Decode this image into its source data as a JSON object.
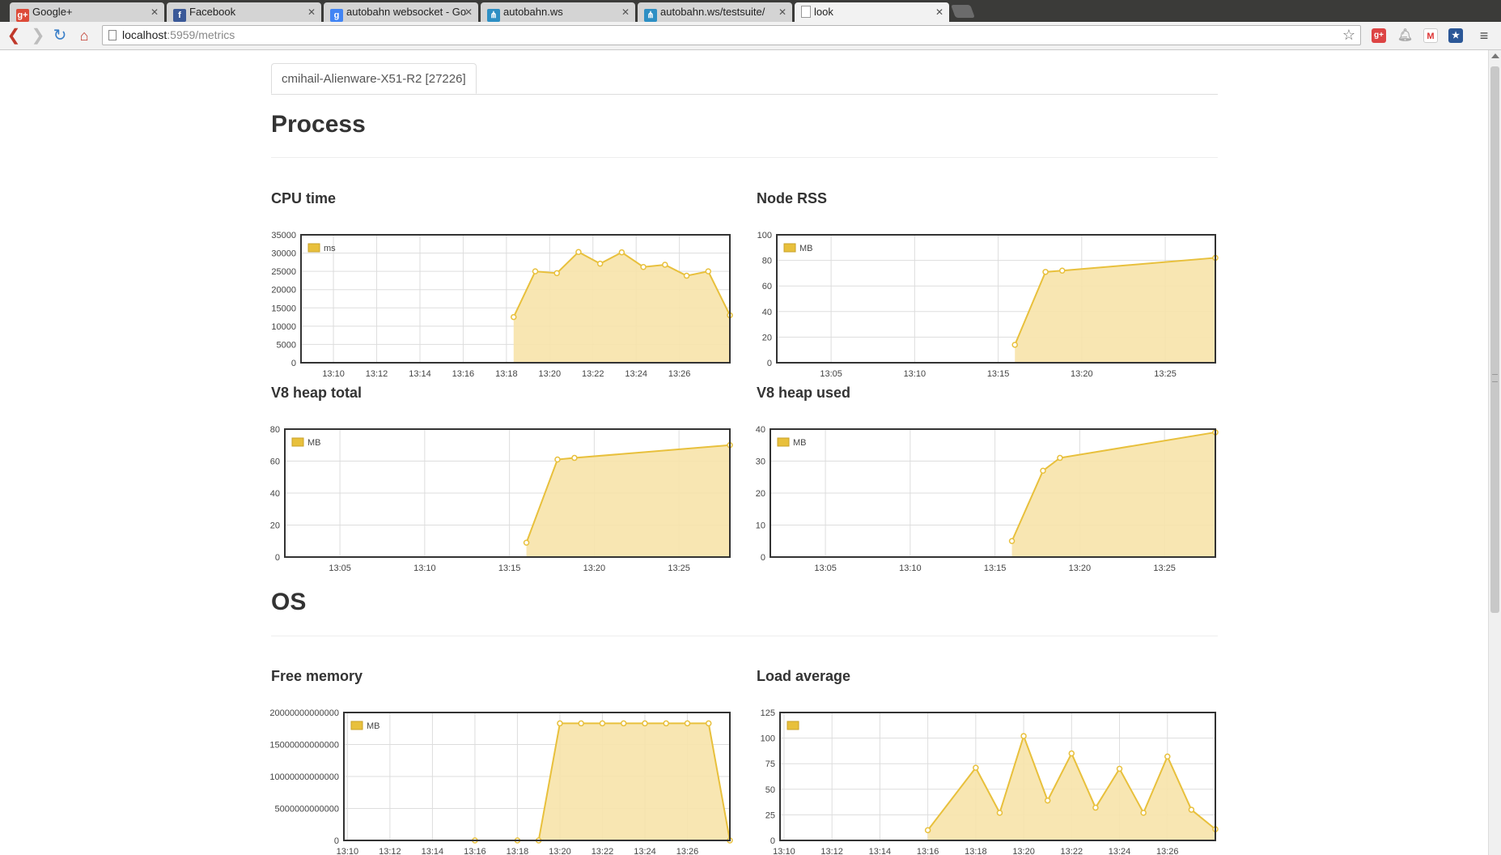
{
  "browser": {
    "tabs": [
      {
        "title": "Google+",
        "icon": "google-plus-icon",
        "color": "#dd4b39",
        "glyph": "g+"
      },
      {
        "title": "Facebook",
        "icon": "facebook-icon",
        "color": "#3b5998",
        "glyph": "f"
      },
      {
        "title": "autobahn websocket - Go",
        "icon": "google-search-icon",
        "color": "#4285f4",
        "glyph": "g"
      },
      {
        "title": "autobahn.ws",
        "icon": "autobahn-icon",
        "color": "#2d8fc4",
        "glyph": "⋔"
      },
      {
        "title": "autobahn.ws/testsuite/",
        "icon": "autobahn-icon",
        "color": "#2d8fc4",
        "glyph": "⋔"
      },
      {
        "title": "look",
        "icon": "page-icon",
        "color": "#ffffff",
        "glyph": ""
      }
    ],
    "active_tab": 5,
    "url_host": "localhost",
    "url_rest": ":5959/metrics"
  },
  "page": {
    "host_tab": "cmihail-Alienware-X51-R2 [27226]",
    "sections": {
      "process": "Process",
      "os": "OS"
    }
  },
  "colors": {
    "series_line": "#e8c03c",
    "series_fill": "#f7e3aa",
    "legend_swatch": "#e8c03c",
    "grid": "#dddddd",
    "frame": "#333333"
  },
  "chart_data": [
    {
      "id": "cpu",
      "type": "area",
      "title": "CPU time",
      "legend": "ms",
      "x_unit": "time",
      "xlim": [
        "13:08:30",
        "13:28:20"
      ],
      "ylim": [
        0,
        35000
      ],
      "yticks": [
        0,
        5000,
        10000,
        15000,
        20000,
        25000,
        30000,
        35000
      ],
      "xticks": [
        "13:10",
        "13:12",
        "13:14",
        "13:16",
        "13:18",
        "13:20",
        "13:22",
        "13:24",
        "13:26"
      ],
      "x": [
        "13:18:20",
        "13:19:20",
        "13:20:20",
        "13:21:20",
        "13:22:20",
        "13:23:20",
        "13:24:20",
        "13:25:20",
        "13:26:20",
        "13:27:20",
        "13:28:20"
      ],
      "y": [
        12500,
        25000,
        24500,
        30300,
        27100,
        30200,
        26200,
        26800,
        23800,
        25000,
        13000
      ]
    },
    {
      "id": "rss",
      "type": "area",
      "title": "Node RSS",
      "legend": "MB",
      "x_unit": "time",
      "xlim": [
        "13:01:45",
        "13:28:00"
      ],
      "ylim": [
        0,
        100
      ],
      "yticks": [
        0,
        20,
        40,
        60,
        80,
        100
      ],
      "xticks": [
        "13:05",
        "13:10",
        "13:15",
        "13:20",
        "13:25"
      ],
      "x": [
        "13:16:00",
        "13:17:50",
        "13:18:50",
        "13:28:00"
      ],
      "y": [
        14,
        71,
        72,
        82
      ]
    },
    {
      "id": "heap_total",
      "type": "area",
      "title": "V8 heap total",
      "legend": "MB",
      "x_unit": "time",
      "xlim": [
        "13:01:45",
        "13:28:00"
      ],
      "ylim": [
        0,
        80
      ],
      "yticks": [
        0,
        20,
        40,
        60,
        80
      ],
      "xticks": [
        "13:05",
        "13:10",
        "13:15",
        "13:20",
        "13:25"
      ],
      "x": [
        "13:16:00",
        "13:17:50",
        "13:18:50",
        "13:28:00"
      ],
      "y": [
        9,
        61,
        62,
        70
      ]
    },
    {
      "id": "heap_used",
      "type": "area",
      "title": "V8 heap used",
      "legend": "MB",
      "x_unit": "time",
      "xlim": [
        "13:01:45",
        "13:28:00"
      ],
      "ylim": [
        0,
        40
      ],
      "yticks": [
        0,
        10,
        20,
        30,
        40
      ],
      "xticks": [
        "13:05",
        "13:10",
        "13:15",
        "13:20",
        "13:25"
      ],
      "x": [
        "13:16:00",
        "13:17:50",
        "13:18:50",
        "13:28:00"
      ],
      "y": [
        5,
        27,
        31,
        39
      ]
    },
    {
      "id": "freemem",
      "type": "area",
      "title": "Free memory",
      "legend": "MB",
      "x_unit": "time",
      "xlim": [
        "13:09:50",
        "13:28:00"
      ],
      "ylim": [
        0,
        20000000000000
      ],
      "yticks": [
        0,
        5000000000000,
        10000000000000,
        15000000000000,
        20000000000000
      ],
      "ytick_labels": [
        "0",
        "5000000000000",
        "10000000000000",
        "15000000000000",
        "20000000000000"
      ],
      "xticks": [
        "13:10",
        "13:12",
        "13:14",
        "13:16",
        "13:18",
        "13:20",
        "13:22",
        "13:24",
        "13:26"
      ],
      "x": [
        "13:16:00",
        "13:18:00",
        "13:19:00",
        "13:20:00",
        "13:21:00",
        "13:22:00",
        "13:23:00",
        "13:24:00",
        "13:25:00",
        "13:26:00",
        "13:27:00",
        "13:28:00"
      ],
      "y": [
        0,
        0,
        0,
        18300000000000,
        18300000000000,
        18300000000000,
        18300000000000,
        18300000000000,
        18300000000000,
        18300000000000,
        18300000000000,
        0
      ]
    },
    {
      "id": "loadavg",
      "type": "area",
      "title": "Load average",
      "legend": "",
      "x_unit": "time",
      "xlim": [
        "13:09:50",
        "13:28:00"
      ],
      "ylim": [
        0,
        125
      ],
      "yticks": [
        0,
        25,
        50,
        75,
        100,
        125
      ],
      "xticks": [
        "13:10",
        "13:12",
        "13:14",
        "13:16",
        "13:18",
        "13:20",
        "13:22",
        "13:24",
        "13:26"
      ],
      "x": [
        "13:16:00",
        "13:18:00",
        "13:19:00",
        "13:20:00",
        "13:21:00",
        "13:22:00",
        "13:23:00",
        "13:24:00",
        "13:25:00",
        "13:26:00",
        "13:27:00",
        "13:28:00"
      ],
      "y": [
        10,
        71,
        27,
        102,
        39,
        85,
        32,
        70,
        27,
        82,
        30,
        11
      ]
    }
  ]
}
